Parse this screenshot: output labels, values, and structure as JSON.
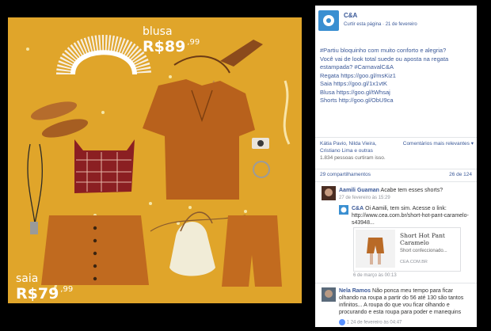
{
  "photo": {
    "blusa": {
      "label": "blusa",
      "amount": "R$89",
      "cents": ",99"
    },
    "saia": {
      "label": "saia",
      "amount": "R$79",
      "cents": ",99"
    }
  },
  "page": {
    "name": "C&A",
    "like_page": "Curtir esta página",
    "date": "21 de fevereiro",
    "brand_color": "#3a8fd1",
    "link_color": "#3b5998"
  },
  "post": {
    "lines": [
      "#Partiu bloquinho com muito conforto e alegria?",
      "Você vai de look total suede ou aposta na regata",
      "estampada? #CarnavalC&A",
      "Regata https://goo.gl/msKiz1",
      "Saia https://goo.gl/1x1vtK",
      "Blusa https://goo.gl/tWhsaj",
      "Shorts http://goo.gl/ObU9ca"
    ]
  },
  "engagement": {
    "likes_line1": "Kátia Pavio, Nilda Vieira,",
    "likes_line2": "Cristiano Lima e outras",
    "likes_line3": "1.834 pessoas curtiram isso.",
    "relevant": "Comentários mais relevantes ▾",
    "shares": "29 compartilhamentos",
    "comments": "26 de 124"
  },
  "comments": [
    {
      "author": "Aamili Guaman",
      "text": "Acabe tem esses shorts?",
      "time": "27 de fevereiro às 15:29"
    },
    {
      "author": "C&A",
      "text": "Oi Aamili, tem sim. Acesse o link: http://www.cea.com.br/short-hot-pant-caramelo-s43948...",
      "time": "6 de março às 00:13"
    },
    {
      "author": "Nela Ramos",
      "text": "Não ponca meu tempo para ficar olhando na roupa a partir do 56 até 130 são tantos infinitos... A roupa do que vou ficar olhando e procurando e esta roupa para poder e manequins magros",
      "time": "24 de fevereiro às 04:47",
      "likes": "1"
    }
  ],
  "link_preview": {
    "title_line1": "Short Hot Pant",
    "title_line2": "Caramelo",
    "description": "Short confeccionado...",
    "domain": "CEA.COM.BR"
  }
}
